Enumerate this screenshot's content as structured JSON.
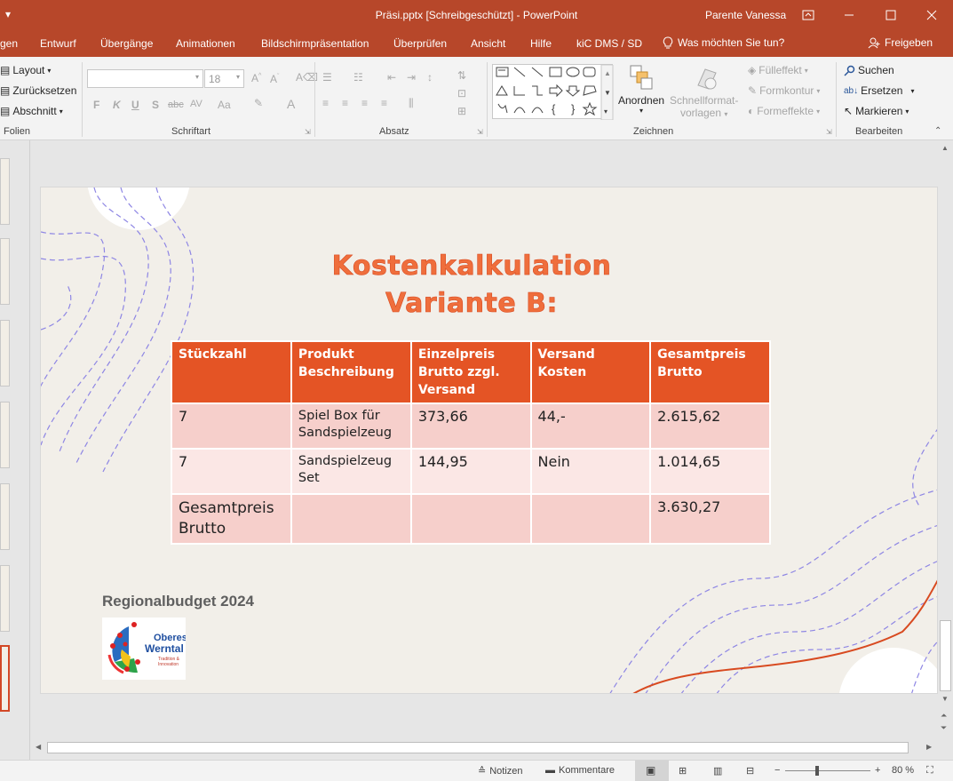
{
  "window": {
    "title": "Präsi.pptx [Schreibgeschützt]  -  PowerPoint",
    "user": "Parente Vanessa",
    "qat_glyph": "▾"
  },
  "tabs": [
    "gen",
    "Entwurf",
    "Übergänge",
    "Animationen",
    "Bildschirmpräsentation",
    "Überprüfen",
    "Ansicht",
    "Hilfe",
    "kiC DMS / SD"
  ],
  "tell_me": "Was möchten Sie tun?",
  "share": "Freigeben",
  "ribbon": {
    "folien": {
      "label": "Folien",
      "layout": "Layout",
      "reset": "Zurücksetzen",
      "section": "Abschnitt"
    },
    "schriftart": {
      "label": "Schriftart",
      "font_name": "",
      "font_size": "18",
      "bold": "F",
      "italic": "K",
      "underline": "U",
      "shadow": "S",
      "strike": "abc",
      "spacing": "AV",
      "case": "Aa",
      "color": "A"
    },
    "absatz": {
      "label": "Absatz"
    },
    "zeichnen": {
      "label": "Zeichnen",
      "arrange": "Anordnen",
      "quick_styles_1": "Schnellformat-",
      "quick_styles_2": "vorlagen",
      "fill": "Fülleffekt",
      "outline": "Formkontur",
      "effects": "Formeffekte"
    },
    "bearbeiten": {
      "label": "Bearbeiten",
      "find": "Suchen",
      "replace": "Ersetzen",
      "select": "Markieren"
    }
  },
  "slide": {
    "title_line1": "Kostenkalkulation",
    "title_line2": "Variante B:",
    "table": {
      "headers": [
        [
          "Stückzahl"
        ],
        [
          "Produkt",
          "Beschreibung"
        ],
        [
          "Einzelpreis",
          "Brutto zzgl.",
          "Versand"
        ],
        [
          "Versand",
          "Kosten"
        ],
        [
          "Gesamtpreis",
          "Brutto"
        ]
      ],
      "rows": [
        {
          "qty": "7",
          "desc": "Spiel Box für Sandspielzeug",
          "price": "373,66",
          "shipping": "44,-",
          "total": "2.615,62"
        },
        {
          "qty": "7",
          "desc": "Sandspielzeug Set",
          "price": "144,95",
          "shipping": "Nein",
          "total": "1.014,65"
        }
      ],
      "sum_label": "Gesamtpreis Brutto",
      "sum_total": "3.630,27"
    },
    "footer_text": "Regionalbudget 2024",
    "logo_text_1": "Oberes",
    "logo_text_2": "Werntal",
    "logo_text_3": "Tradition &",
    "logo_text_4": "Innovation"
  },
  "status": {
    "notes": "Notizen",
    "comments": "Kommentare",
    "zoom": "80 %"
  },
  "colors": {
    "brand": "#b7472a",
    "title_orange": "#ef6e3c",
    "header_orange": "#e45425",
    "row_odd": "#f6cfcb",
    "row_even": "#fbe7e5"
  }
}
